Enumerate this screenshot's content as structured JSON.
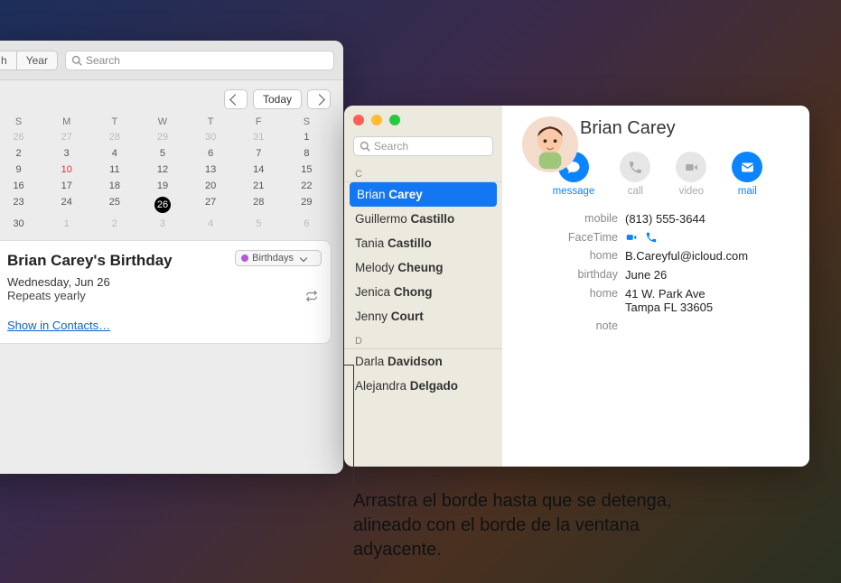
{
  "calendar": {
    "tabs": {
      "month": "h",
      "year": "Year"
    },
    "search_placeholder": "Search",
    "today_label": "Today",
    "day_headers": [
      "S",
      "M",
      "T",
      "W",
      "T",
      "F",
      "S"
    ],
    "weeks": [
      [
        {
          "n": "26",
          "dim": true
        },
        {
          "n": "27",
          "dim": true
        },
        {
          "n": "28",
          "dim": true
        },
        {
          "n": "29",
          "dim": true
        },
        {
          "n": "30",
          "dim": true
        },
        {
          "n": "31",
          "dim": true
        },
        {
          "n": "1"
        }
      ],
      [
        {
          "n": "2"
        },
        {
          "n": "3"
        },
        {
          "n": "4"
        },
        {
          "n": "5"
        },
        {
          "n": "6"
        },
        {
          "n": "7"
        },
        {
          "n": "8"
        }
      ],
      [
        {
          "n": "9"
        },
        {
          "n": "10",
          "red": true
        },
        {
          "n": "11"
        },
        {
          "n": "12"
        },
        {
          "n": "13"
        },
        {
          "n": "14"
        },
        {
          "n": "15"
        }
      ],
      [
        {
          "n": "16"
        },
        {
          "n": "17"
        },
        {
          "n": "18"
        },
        {
          "n": "19"
        },
        {
          "n": "20"
        },
        {
          "n": "21"
        },
        {
          "n": "22"
        }
      ],
      [
        {
          "n": "23"
        },
        {
          "n": "24"
        },
        {
          "n": "25"
        },
        {
          "n": "26",
          "sel": true
        },
        {
          "n": "27"
        },
        {
          "n": "28"
        },
        {
          "n": "29"
        }
      ],
      [
        {
          "n": "30"
        },
        {
          "n": "1",
          "dim": true
        },
        {
          "n": "2",
          "dim": true
        },
        {
          "n": "3",
          "dim": true
        },
        {
          "n": "4",
          "dim": true
        },
        {
          "n": "5",
          "dim": true
        },
        {
          "n": "6",
          "dim": true
        }
      ]
    ],
    "event": {
      "title": "Brian Carey's Birthday",
      "calendar_select": "Birthdays",
      "date": "Wednesday, Jun 26",
      "repeat": "Repeats yearly",
      "link": "Show in Contacts…"
    }
  },
  "contacts": {
    "search_placeholder": "Search",
    "sections": [
      {
        "label": "C",
        "items": [
          {
            "first": "Brian",
            "last": "Carey",
            "selected": true
          },
          {
            "first": "Guillermo",
            "last": "Castillo"
          },
          {
            "first": "Tania",
            "last": "Castillo"
          },
          {
            "first": "Melody",
            "last": "Cheung"
          },
          {
            "first": "Jenica",
            "last": "Chong"
          },
          {
            "first": "Jenny",
            "last": "Court"
          }
        ]
      },
      {
        "label": "D",
        "items": [
          {
            "first": "Darla",
            "last": "Davidson"
          },
          {
            "first": "Alejandra",
            "last": "Delgado"
          }
        ]
      }
    ],
    "card": {
      "name": "Brian Carey",
      "actions": {
        "message": "message",
        "call": "call",
        "video": "video",
        "mail": "mail"
      },
      "fields": {
        "mobile_label": "mobile",
        "mobile": "(813) 555-3644",
        "facetime_label": "FaceTime",
        "home_email_label": "home",
        "home_email": "B.Careyful@icloud.com",
        "birthday_label": "birthday",
        "birthday": "June 26",
        "home_addr_label": "home",
        "home_addr_l1": "41 W. Park Ave",
        "home_addr_l2": "Tampa FL 33605",
        "note_label": "note"
      }
    }
  },
  "callout": "Arrastra el borde hasta que se detenga, alineado con el borde de la ventana adyacente."
}
